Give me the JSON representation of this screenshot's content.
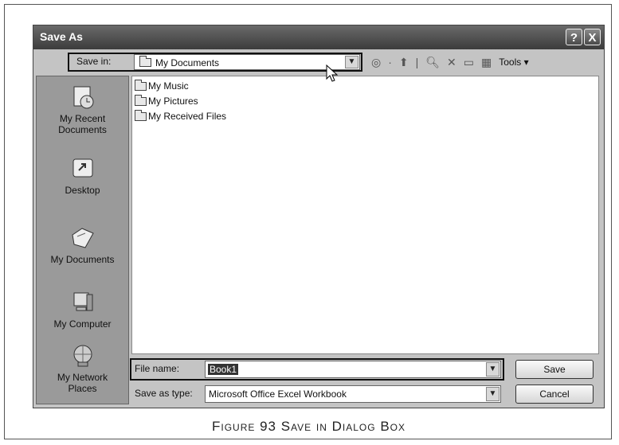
{
  "dialog": {
    "title": "Save As",
    "help_button": "?",
    "close_button": "X"
  },
  "toolbar": {
    "save_in_label": "Save in:",
    "save_in_value": "My Documents",
    "tools_label": "Tools"
  },
  "places": [
    {
      "label": "My Recent Documents",
      "icon": "recent-documents-icon"
    },
    {
      "label": "Desktop",
      "icon": "desktop-icon"
    },
    {
      "label": "My Documents",
      "icon": "my-documents-icon"
    },
    {
      "label": "My Computer",
      "icon": "my-computer-icon"
    },
    {
      "label": "My Network Places",
      "icon": "network-places-icon"
    }
  ],
  "files": [
    {
      "name": "My Music",
      "icon": "music-folder-icon"
    },
    {
      "name": "My Pictures",
      "icon": "pictures-folder-icon"
    },
    {
      "name": "My Received Files",
      "icon": "folder-icon"
    }
  ],
  "bottom": {
    "file_name_label": "File name:",
    "file_name_value": "Book1",
    "save_as_type_label": "Save as type:",
    "save_as_type_value": "Microsoft Office Excel Workbook",
    "save_button": "Save",
    "cancel_button": "Cancel"
  },
  "caption": "Figure 93 Save in Dialog Box"
}
